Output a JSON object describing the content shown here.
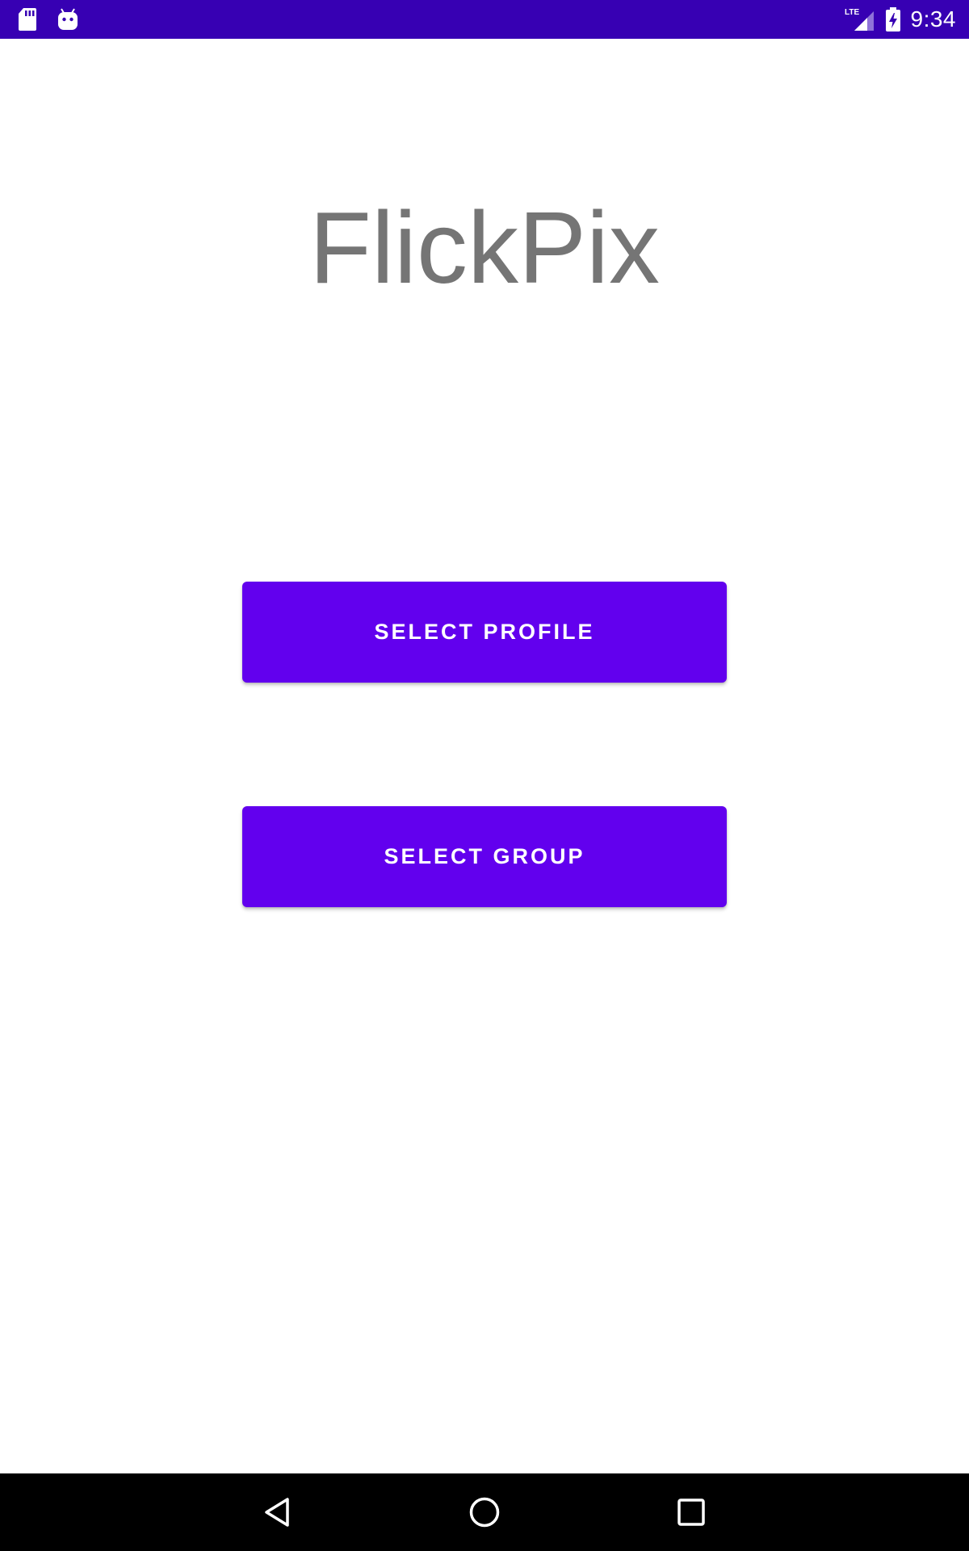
{
  "status_bar": {
    "time": "9:34",
    "network": "LTE",
    "left_icons": [
      "sd-card-icon",
      "android-debug-icon"
    ],
    "right_icons": [
      "lte-signal-icon",
      "battery-charging-icon"
    ],
    "background": "#3700b3"
  },
  "app": {
    "title": "FlickPix",
    "title_color": "#757575"
  },
  "buttons": {
    "select_profile": "SELECT PROFILE",
    "select_group": "SELECT GROUP",
    "color": "#6200ee"
  },
  "nav_bar": {
    "icons": [
      "back-icon",
      "home-icon",
      "recents-icon"
    ],
    "background": "#000000"
  }
}
